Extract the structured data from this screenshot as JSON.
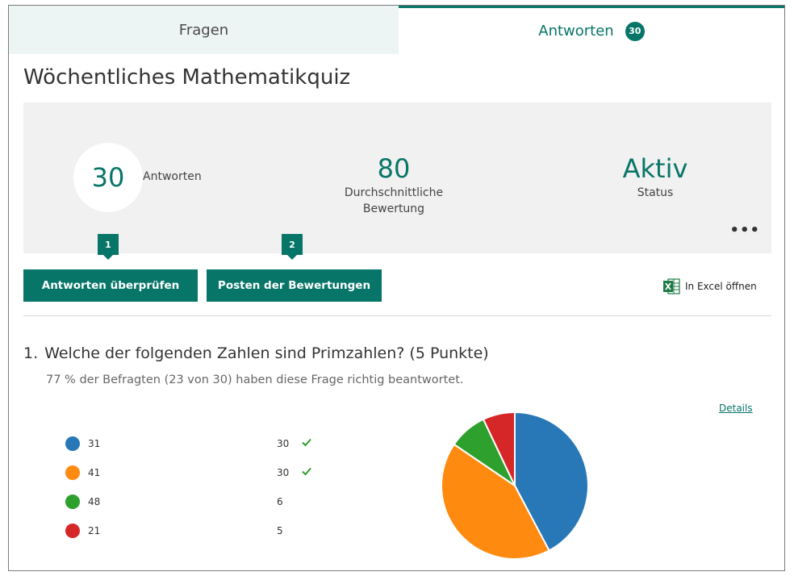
{
  "tabs": {
    "questions_label": "Fragen",
    "responses_label": "Antworten",
    "responses_badge": "30"
  },
  "quiz_title": "Wöchentliches Mathematikquiz",
  "summary": {
    "responses_count": "30",
    "responses_label": "Antworten",
    "average_value": "80",
    "average_label": "Durchschnittliche Bewertung",
    "status_value": "Aktiv",
    "status_label": "Status",
    "more_label": "•••"
  },
  "callouts": {
    "first": "1",
    "second": "2"
  },
  "actions": {
    "review_label": "Antworten überprüfen",
    "post_label": "Posten der Bewertungen",
    "excel_label": "In Excel öffnen"
  },
  "question": {
    "number": "1.",
    "title": "Welche der folgenden Zahlen sind Primzahlen? (5 Punkte)",
    "subtitle": "77 % der Befragten (23 von 30) haben diese Frage richtig beantwortet.",
    "details_label": "Details"
  },
  "colors": {
    "accent": "#077568",
    "check": "#2e9e2e"
  },
  "chart_data": {
    "type": "pie",
    "categories": [
      "31",
      "41",
      "48",
      "21"
    ],
    "values": [
      30,
      30,
      6,
      5
    ],
    "correct": [
      true,
      true,
      false,
      false
    ],
    "colors": [
      "#2878b8",
      "#ff8a10",
      "#2ea02e",
      "#d62728"
    ]
  }
}
